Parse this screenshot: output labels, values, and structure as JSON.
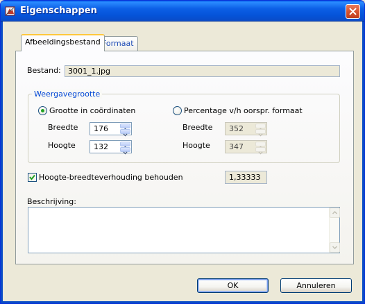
{
  "window": {
    "title": "Eigenschappen"
  },
  "tabs": [
    {
      "label": "Afbeeldingsbestand",
      "active": true
    },
    {
      "label": "Formaat",
      "active": false
    }
  ],
  "file": {
    "label": "Bestand:",
    "value": "3001_1.jpg"
  },
  "display_size": {
    "group_label": "Weergavegrootte",
    "coords_option": {
      "label": "Grootte in coördinaten",
      "selected": true,
      "width_label": "Breedte",
      "width_value": "176",
      "height_label": "Hoogte",
      "height_value": "132"
    },
    "percent_option": {
      "label": "Percentage v/h oorspr. formaat",
      "selected": false,
      "width_label": "Breedte",
      "width_value": "352",
      "height_label": "Hoogte",
      "height_value": "347"
    }
  },
  "aspect": {
    "label": "Hoogte-breedteverhouding behouden",
    "checked": true,
    "ratio": "1,33333"
  },
  "description": {
    "label": "Beschrijving:",
    "value": ""
  },
  "buttons": {
    "ok": "OK",
    "cancel": "Annuleren"
  },
  "colors": {
    "titlebar": "#0a5ae0",
    "accent_text": "#0046d5",
    "radio_dot": "#21a121",
    "check": "#21a121"
  }
}
